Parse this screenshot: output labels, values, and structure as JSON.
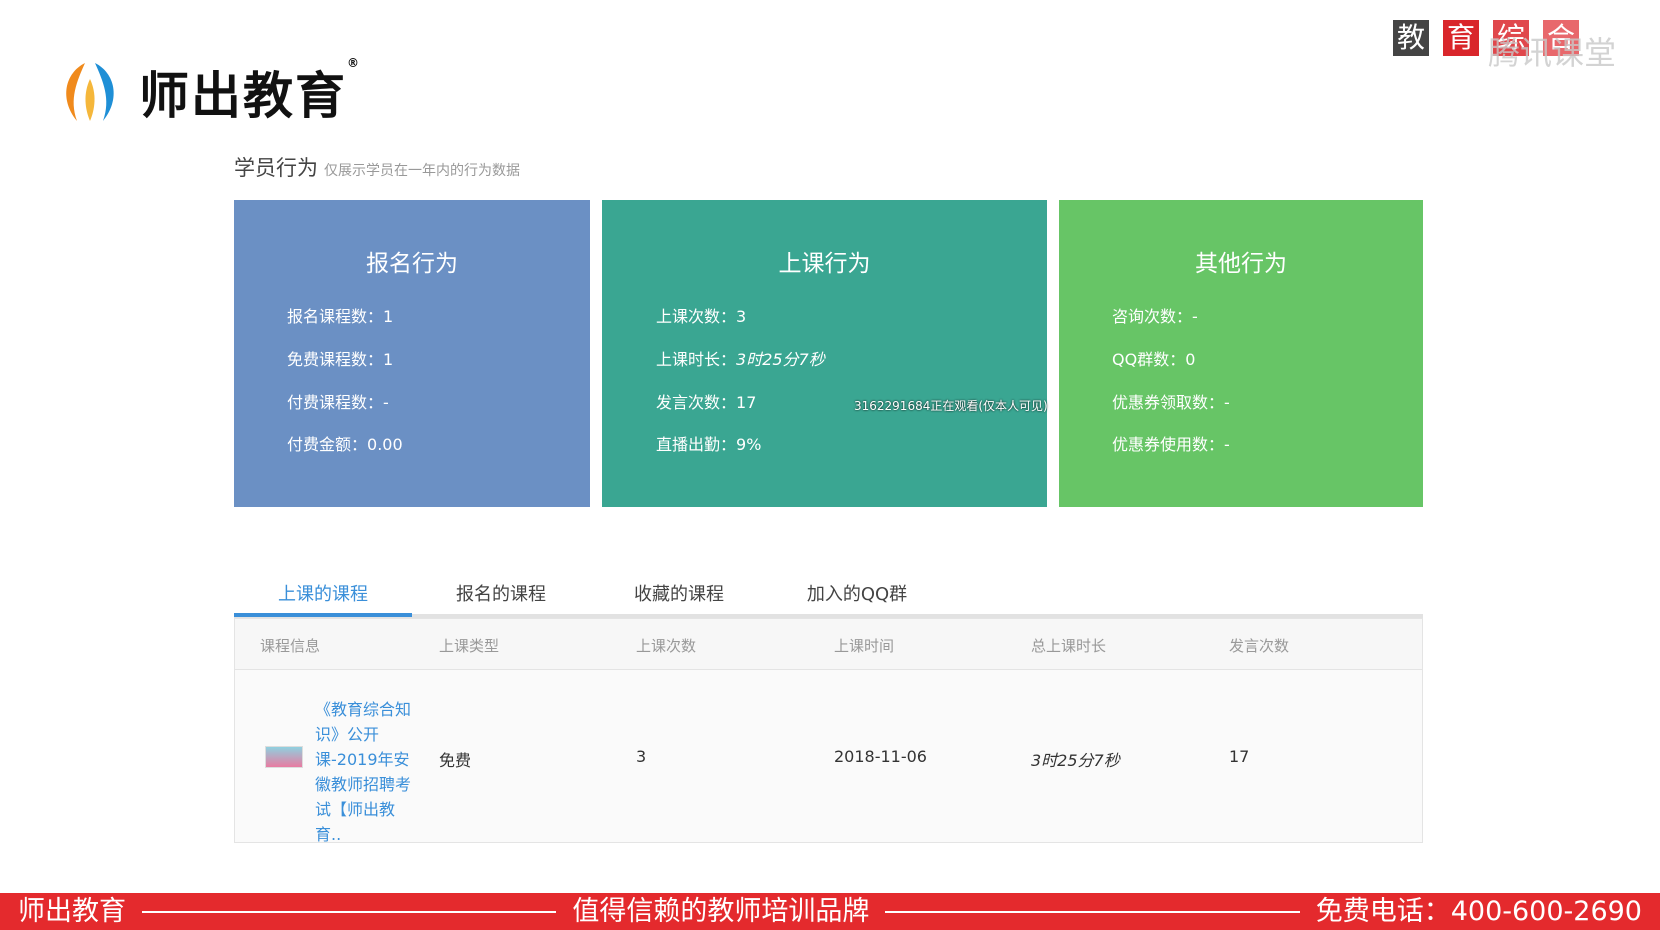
{
  "brand": {
    "name": "师出教育",
    "reg": "®"
  },
  "watermark": {
    "chars": [
      "教",
      "育",
      "综",
      "合"
    ],
    "text": "腾讯课堂"
  },
  "section": {
    "title": "学员行为",
    "subtitle": "仅展示学员在一年内的行为数据"
  },
  "cards": [
    {
      "title": "报名行为",
      "items": [
        {
          "label": "报名课程数：",
          "value": "1"
        },
        {
          "label": "免费课程数：",
          "value": "1"
        },
        {
          "label": "付费课程数：",
          "value": "-"
        },
        {
          "label": "付费金额：",
          "value": "0.00"
        }
      ]
    },
    {
      "title": "上课行为",
      "items": [
        {
          "label": "上课次数：",
          "value": "3"
        },
        {
          "label": "上课时长：",
          "value": "3时25分7秒"
        },
        {
          "label": "发言次数：",
          "value": "17"
        },
        {
          "label": "直播出勤：",
          "value": "9%"
        }
      ]
    },
    {
      "title": "其他行为",
      "items": [
        {
          "label": "咨询次数：",
          "value": "-"
        },
        {
          "label": "QQ群数：",
          "value": "0"
        },
        {
          "label": "优惠券领取数：",
          "value": "-"
        },
        {
          "label": "优惠券使用数：",
          "value": "-"
        }
      ]
    }
  ],
  "overlay": "3162291684正在观看(仅本人可见)",
  "tabs": [
    "上课的课程",
    "报名的课程",
    "收藏的课程",
    "加入的QQ群"
  ],
  "table": {
    "headers": [
      "课程信息",
      "上课类型",
      "上课次数",
      "上课时间",
      "总上课时长",
      "发言次数"
    ],
    "rows": [
      {
        "course": "《教育综合知识》公开课-2019年安徽教师招聘考试【师出教育..",
        "type": "免费",
        "count": "3",
        "date": "2018-11-06",
        "duration": "3时25分7秒",
        "speaks": "17"
      }
    ]
  },
  "footer": {
    "left": "师出教育",
    "center": "值得信赖的教师培训品牌",
    "right": "免费电话：400-600-2690"
  },
  "colors": {
    "blue": "#6b90c4",
    "teal": "#3aa692",
    "green": "#67c566",
    "accent": "#3a8fd9",
    "footer": "#e42a2d"
  }
}
